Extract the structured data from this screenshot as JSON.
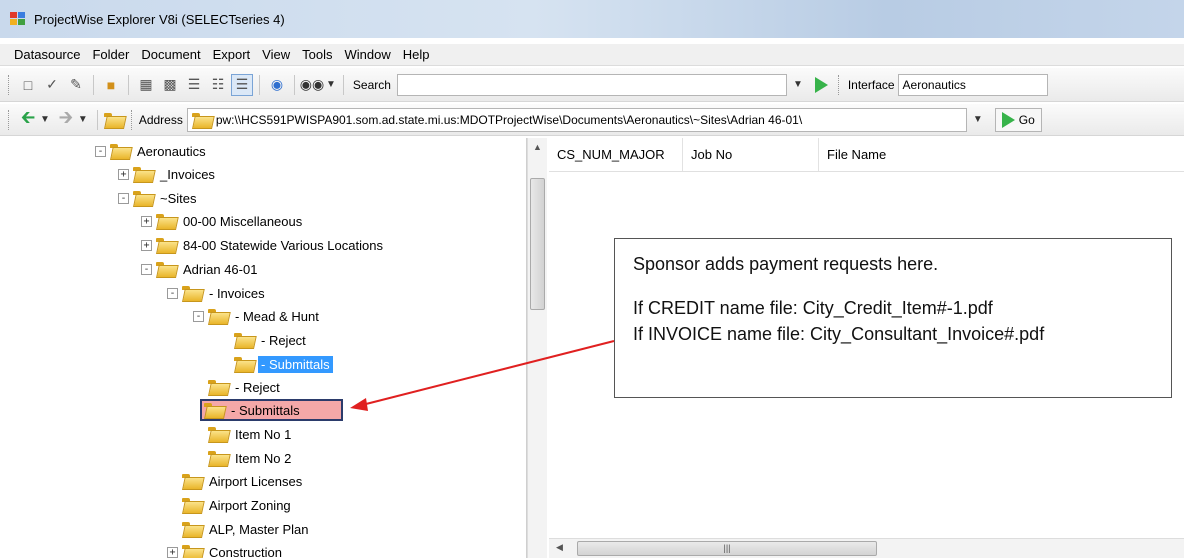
{
  "window": {
    "title": "ProjectWise Explorer V8i (SELECTseries 4)"
  },
  "menu": [
    "Datasource",
    "Folder",
    "Document",
    "Export",
    "View",
    "Tools",
    "Window",
    "Help"
  ],
  "toolbar": {
    "search_label": "Search",
    "search_value": "",
    "interface_label": "Interface",
    "interface_value": "Aeronautics"
  },
  "address": {
    "label": "Address",
    "value": "pw:\\\\HCS591PWISPA901.som.ad.state.mi.us:MDOTProjectWise\\Documents\\Aeronautics\\~Sites\\Adrian 46-01\\",
    "go_label": "Go"
  },
  "tree": [
    {
      "label": "Aeronautics",
      "expander": "-"
    },
    {
      "label": "_Invoices",
      "expander": "+"
    },
    {
      "label": "~Sites",
      "expander": "-"
    },
    {
      "label": "00-00 Miscellaneous",
      "expander": "+"
    },
    {
      "label": "84-00 Statewide Various Locations",
      "expander": "+"
    },
    {
      "label": "Adrian 46-01",
      "expander": "-"
    },
    {
      "label": "- Invoices",
      "expander": "-"
    },
    {
      "label": "- Mead & Hunt",
      "expander": "-"
    },
    {
      "label": "- Reject",
      "expander": ""
    },
    {
      "label": "- Submittals",
      "expander": "",
      "state": "selected"
    },
    {
      "label": "- Reject",
      "expander": ""
    },
    {
      "label": "- Submittals",
      "expander": "",
      "state": "highlighted"
    },
    {
      "label": "Item No 1",
      "expander": ""
    },
    {
      "label": "Item No 2",
      "expander": ""
    },
    {
      "label": "Airport Licenses",
      "expander": ""
    },
    {
      "label": "Airport Zoning",
      "expander": ""
    },
    {
      "label": "ALP, Master Plan",
      "expander": ""
    },
    {
      "label": "Construction",
      "expander": "+"
    }
  ],
  "list": {
    "columns": [
      "CS_NUM_MAJOR",
      "Job No",
      "File Name"
    ]
  },
  "callout": {
    "line1": "Sponsor adds payment requests here.",
    "line2": "If CREDIT name file: City_Credit_Item#-1.pdf",
    "line3": "If INVOICE name file: City_Consultant_Invoice#.pdf"
  },
  "colors": {
    "arrow": "#e02020",
    "selection": "#3399ff",
    "highlight": "#f4a8a8",
    "go": "#37b34a"
  }
}
